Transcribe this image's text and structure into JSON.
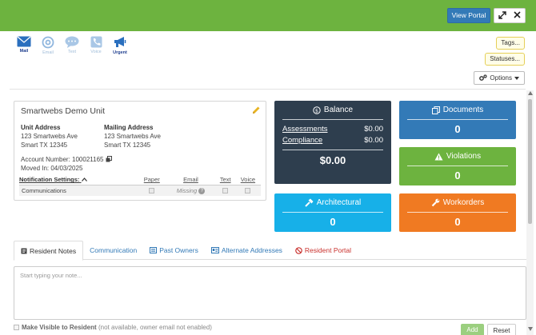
{
  "header": {
    "view_portal_label": "View Portal",
    "colors": {
      "bar": "#6db33f",
      "primary": "#337ab7"
    }
  },
  "comm_bar": {
    "items": [
      {
        "label": "Mail",
        "icon": "mail-icon",
        "active": true
      },
      {
        "label": "Email",
        "icon": "email-at-icon",
        "active": false
      },
      {
        "label": "Text",
        "icon": "text-bubble-icon",
        "active": false
      },
      {
        "label": "Voice",
        "icon": "phone-icon",
        "active": false
      },
      {
        "label": "Urgent",
        "icon": "megaphone-icon",
        "active": true
      }
    ]
  },
  "right_buttons": {
    "tags_label": "Tags...",
    "statuses_label": "Statuses...",
    "options_label": "Options"
  },
  "unit": {
    "title": "Smartwebs Demo Unit",
    "unit_address": {
      "heading": "Unit Address",
      "line1": "123 Smartwebs Ave",
      "line2": "Smart TX 12345"
    },
    "mailing_address": {
      "heading": "Mailing Address",
      "line1": "123 Smartwebs Ave",
      "line2": "Smart TX 12345"
    },
    "account_number": "Account Number: 100021165",
    "moved_in": "Moved In: 04/03/2025",
    "notifications": {
      "heading": "Notification Settings:",
      "columns": [
        "Paper",
        "Email",
        "Text",
        "Voice"
      ],
      "rows": [
        {
          "label": "Communications",
          "email_status": "Missing"
        }
      ]
    }
  },
  "tiles": {
    "balance": {
      "title": "Balance",
      "assessments_label": "Assessments",
      "assessments_value": "$0.00",
      "compliance_label": "Compliance",
      "compliance_value": "$0.00",
      "total": "$0.00",
      "color": "#2e3e4e"
    },
    "documents": {
      "title": "Documents",
      "value": "0",
      "color": "#337ab7"
    },
    "violations": {
      "title": "Violations",
      "value": "0",
      "color": "#6db33f"
    },
    "architectural": {
      "title": "Architectural",
      "value": "0",
      "color": "#17b0e8"
    },
    "workorders": {
      "title": "Workorders",
      "value": "0",
      "color": "#f07a22"
    }
  },
  "tabs": [
    {
      "label": "Resident Notes",
      "icon": "note-icon",
      "active": true
    },
    {
      "label": "Communication",
      "active": false
    },
    {
      "label": "Past Owners",
      "icon": "list-icon",
      "active": false
    },
    {
      "label": "Alternate Addresses",
      "icon": "id-card-icon",
      "active": false
    },
    {
      "label": "Resident Portal",
      "icon": "ban-icon",
      "active": false,
      "color": "#c9302c"
    }
  ],
  "note": {
    "placeholder": "Start typing your note...",
    "visible_label": "Make Visible to Resident",
    "visible_note": "(not available, owner email not enabled)",
    "add_label": "Add",
    "reset_label": "Reset"
  }
}
